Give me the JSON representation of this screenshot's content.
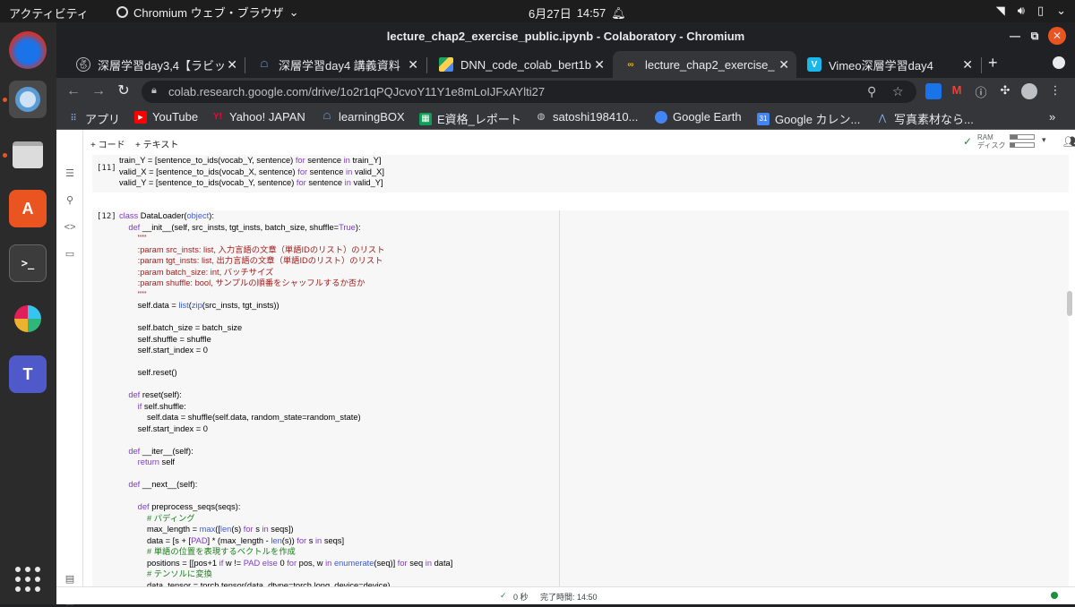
{
  "topbar": {
    "activities": "アクティビティ",
    "app_name": "Chromium ウェブ・ブラウザ",
    "date": "6月27日",
    "time": "14:57"
  },
  "window": {
    "title": "lecture_chap2_exercise_public.ipynb - Colaboratory - Chromium"
  },
  "tabs": [
    {
      "label": "深層学習day3,4【ラビッ",
      "icon": "rabbit-icon"
    },
    {
      "label": "深層学習day4 講義資料",
      "icon": "learningbox-icon"
    },
    {
      "label": "DNN_code_colab_bert1b",
      "icon": "google-drive-icon"
    },
    {
      "label": "lecture_chap2_exercise_",
      "icon": "colab-icon"
    },
    {
      "label": "Vimeo深層学習day4",
      "icon": "vimeo-icon"
    }
  ],
  "omnibox": {
    "url": "colab.research.google.com/drive/1o2r1qPQJcvoY11Y1e8mLoIJFxAYlti27"
  },
  "bookmarks": [
    {
      "label": "アプリ",
      "icon": "apps-grid-icon"
    },
    {
      "label": "YouTube",
      "icon": "youtube-icon"
    },
    {
      "label": "Yahoo! JAPAN",
      "icon": "yahoo-icon"
    },
    {
      "label": "learningBOX",
      "icon": "learningbox-icon"
    },
    {
      "label": "E資格_レポート",
      "icon": "sheets-icon"
    },
    {
      "label": "satoshi198410...",
      "icon": "github-icon"
    },
    {
      "label": "Google Earth",
      "icon": "earth-icon"
    },
    {
      "label": "Google カレン...",
      "icon": "calendar-icon"
    },
    {
      "label": "写真素材なら...",
      "icon": "photo-icon"
    }
  ],
  "colab": {
    "add_code": "+ コード",
    "add_text": "+ テキスト",
    "ram_label": "RAM",
    "disk_label": "ディスク",
    "ram_usage": 0.3,
    "disk_usage": 0.2
  },
  "cell11": {
    "number": "[11]",
    "lines": [
      "train_Y = [sentence_to_ids(vocab_Y, sentence) for sentence in train_Y]",
      "valid_X = [sentence_to_ids(vocab_X, sentence) for sentence in valid_X]",
      "valid_Y = [sentence_to_ids(vocab_Y, sentence) for sentence in valid_Y]"
    ]
  },
  "cell12": {
    "number": "[12]",
    "lines": [
      "class DataLoader(object):",
      "    def __init__(self, src_insts, tgt_insts, batch_size, shuffle=True):",
      "        \"\"\"",
      "        :param src_insts: list, 入力言語の文章（単語IDのリスト）のリスト",
      "        :param tgt_insts: list, 出力言語の文章（単語IDのリスト）のリスト",
      "        :param batch_size: int, バッチサイズ",
      "        :param shuffle: bool, サンプルの順番をシャッフルするか否か",
      "        \"\"\"",
      "        self.data = list(zip(src_insts, tgt_insts))",
      "",
      "        self.batch_size = batch_size",
      "        self.shuffle = shuffle",
      "        self.start_index = 0",
      "",
      "        self.reset()",
      "",
      "    def reset(self):",
      "        if self.shuffle:",
      "            self.data = shuffle(self.data, random_state=random_state)",
      "        self.start_index = 0",
      "",
      "    def __iter__(self):",
      "        return self",
      "",
      "    def __next__(self):",
      "",
      "        def preprocess_seqs(seqs):",
      "            # パディング",
      "            max_length = max([len(s) for s in seqs])",
      "            data = [s + [PAD] * (max_length - len(s)) for s in seqs]",
      "            # 単語の位置を表現するベクトルを作成",
      "            positions = [[pos+1 if w != PAD else 0 for pos, w in enumerate(seq)] for seq in data]",
      "            # テンソルに変換",
      "            data_tensor = torch.tensor(data, dtype=torch.long, device=device)"
    ]
  },
  "status": {
    "check": "✓",
    "elapsed": "0 秒",
    "completed": "完了時間: 14:50"
  }
}
